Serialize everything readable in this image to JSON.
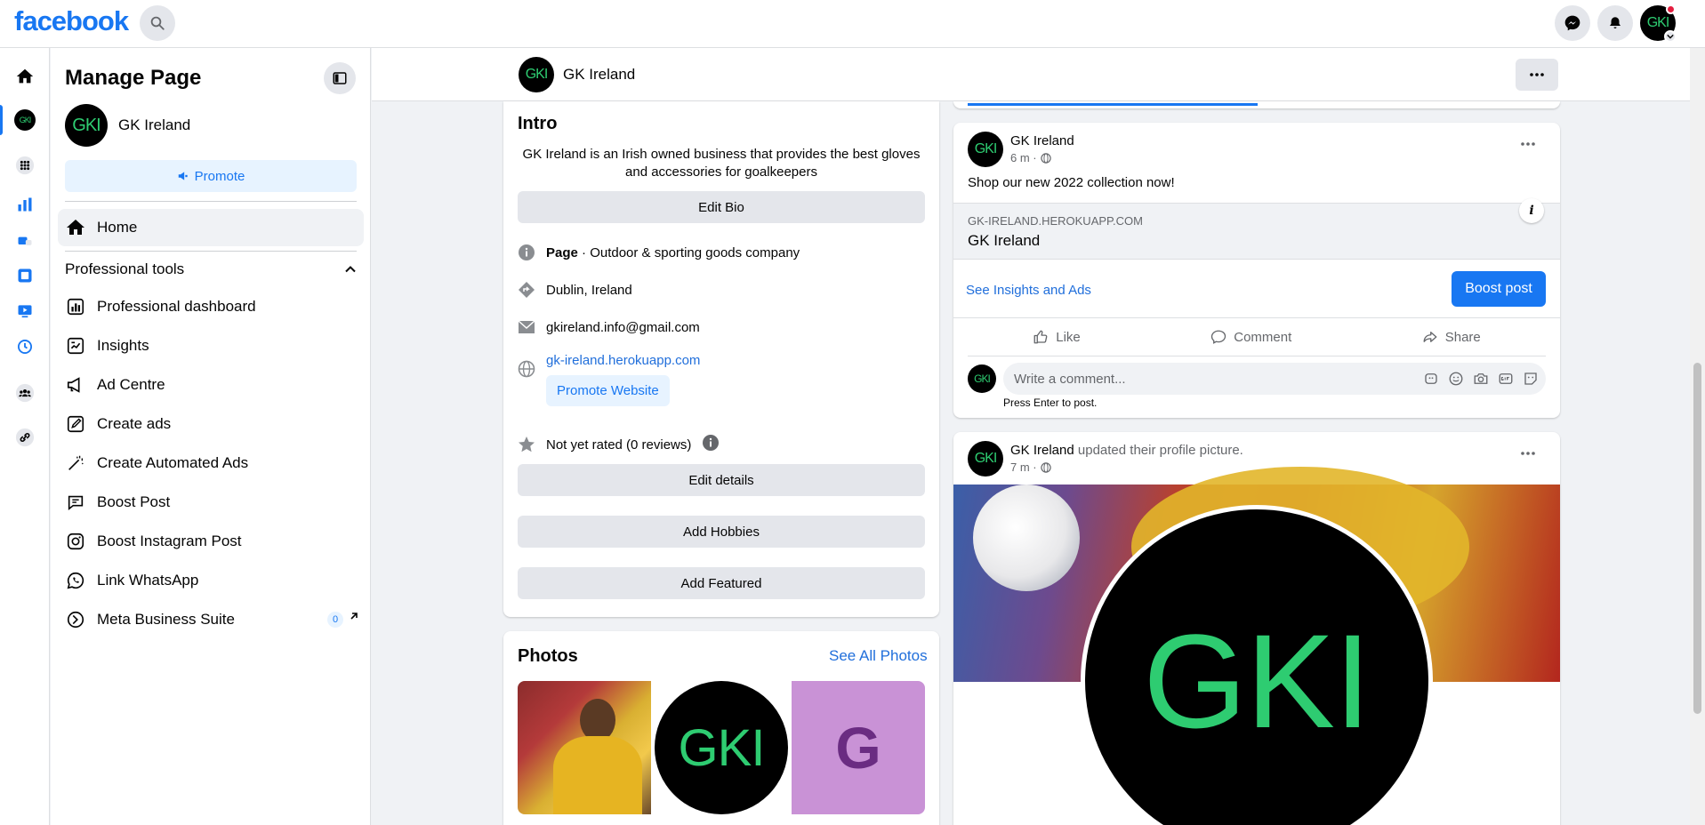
{
  "topbar": {
    "logo": "facebook",
    "avatar_initials": "GKI"
  },
  "panel": {
    "title": "Manage Page",
    "page_name": "GK Ireland",
    "page_avatar": "GKI",
    "promote_label": "Promote",
    "home_label": "Home",
    "tools_heading": "Professional tools",
    "tools": [
      {
        "label": "Professional dashboard",
        "icon": "dashboard-icon"
      },
      {
        "label": "Insights",
        "icon": "insights-icon"
      },
      {
        "label": "Ad Centre",
        "icon": "megaphone-icon"
      },
      {
        "label": "Create ads",
        "icon": "pencil-icon"
      },
      {
        "label": "Create Automated Ads",
        "icon": "magic-wand-icon"
      },
      {
        "label": "Boost Post",
        "icon": "boost-post-icon"
      },
      {
        "label": "Boost Instagram Post",
        "icon": "instagram-icon"
      },
      {
        "label": "Link WhatsApp",
        "icon": "whatsapp-icon"
      },
      {
        "label": "Meta Business Suite",
        "icon": "meta-business-suite-icon",
        "badge": "0"
      }
    ]
  },
  "header": {
    "page_name": "GK Ireland",
    "avatar": "GKI"
  },
  "intro": {
    "title": "Intro",
    "bio": "GK Ireland is an Irish owned business that provides the best gloves and accessories for goalkeepers",
    "edit_bio": "Edit Bio",
    "category_bold": "Page",
    "category_rest": " · Outdoor & sporting goods company",
    "location": "Dublin, Ireland",
    "email": "gkireland.info@gmail.com",
    "website": "gk-ireland.herokuapp.com",
    "promote_website": "Promote Website",
    "rating": "Not yet rated (0 reviews)",
    "edit_details": "Edit details",
    "add_hobbies": "Add Hobbies",
    "add_featured": "Add Featured"
  },
  "photos": {
    "title": "Photos",
    "see_all": "See All Photos",
    "gki_text": "GKI",
    "g_text": "G"
  },
  "post1": {
    "name": "GK Ireland",
    "time": "6 m ·",
    "text": "Shop our new 2022 collection now!",
    "link_domain": "GK-IRELAND.HEROKUAPP.COM",
    "link_title": "GK Ireland",
    "insights": "See Insights and Ads",
    "boost": "Boost post",
    "like": "Like",
    "comment": "Comment",
    "share": "Share",
    "comment_placeholder": "Write a comment...",
    "press_enter": "Press Enter to post."
  },
  "post2": {
    "name": "GK Ireland",
    "action": " updated their profile picture.",
    "time": "7 m ·",
    "big_text": "GKI"
  },
  "colors": {
    "brand": "#1877f2",
    "gki_green": "#2ecc71"
  }
}
